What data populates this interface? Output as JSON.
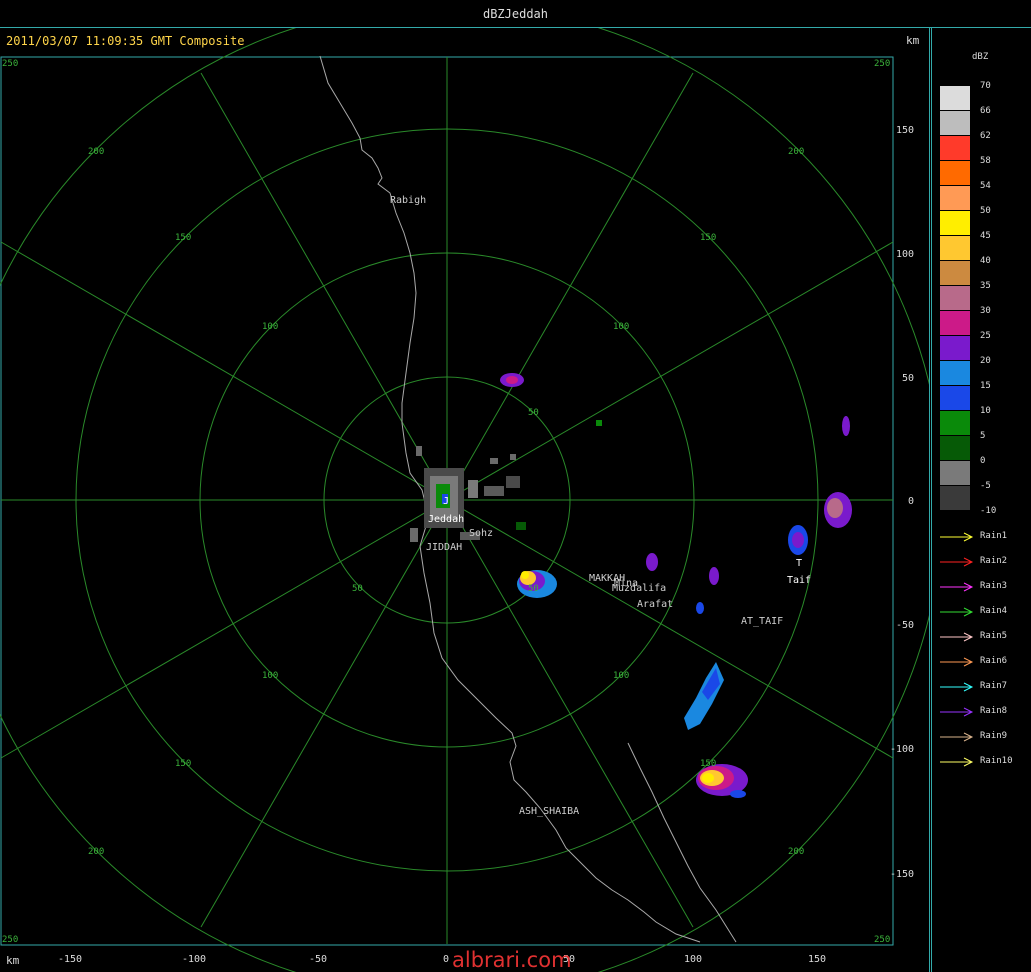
{
  "window": {
    "title": "dBZJeddah"
  },
  "radar": {
    "timestamp": "2011/03/07 11:09:35 GMT Composite",
    "unit": "km",
    "watermark": "albrari.com",
    "ring_labels": [
      "50",
      "100",
      "150",
      "200",
      "250"
    ],
    "x_ticks": [
      "-150",
      "-100",
      "-50",
      "0",
      "50",
      "100",
      "150"
    ],
    "y_ticks": [
      "150",
      "100",
      "50",
      "0",
      "-50",
      "-100",
      "-150"
    ],
    "places": {
      "rabigh": "Rabigh",
      "jeddah_marker": "J",
      "jeddah": "Jeddah",
      "jiddah": "JIDDAH",
      "sohz": "Sohz",
      "makkah": "MAKKAH",
      "mina": "Mina",
      "muzdalifa": "Muzdalifa",
      "arafat": "Arafat",
      "at_taif": "AT_TAIF",
      "taif_marker": "T",
      "taif": "Taif",
      "ash_shaiba": "ASH_SHAIBA"
    }
  },
  "legend": {
    "unit": "dBZ",
    "scale": [
      {
        "value": "70",
        "color": "#dcdcdc"
      },
      {
        "value": "66",
        "color": "#bdbdbd"
      },
      {
        "value": "62",
        "color": "#ff3a2a"
      },
      {
        "value": "58",
        "color": "#ff6a00"
      },
      {
        "value": "54",
        "color": "#ff9a55"
      },
      {
        "value": "50",
        "color": "#ffee00"
      },
      {
        "value": "45",
        "color": "#ffc830"
      },
      {
        "value": "40",
        "color": "#cc8a40"
      },
      {
        "value": "35",
        "color": "#b86a8a"
      },
      {
        "value": "30",
        "color": "#cc1a88"
      },
      {
        "value": "25",
        "color": "#7a1acc"
      },
      {
        "value": "20",
        "color": "#1a88e0"
      },
      {
        "value": "15",
        "color": "#1a48e8"
      },
      {
        "value": "10",
        "color": "#0a8a0a"
      },
      {
        "value": "5",
        "color": "#065a06"
      },
      {
        "value": "0",
        "color": "#7a7a7a"
      },
      {
        "value": "-5",
        "color": "#3a3a3a"
      }
    ],
    "bottom_value": "-10",
    "rain": [
      {
        "label": "Rain1",
        "color": "#ffff33"
      },
      {
        "label": "Rain2",
        "color": "#ff2222"
      },
      {
        "label": "Rain3",
        "color": "#ff33ff"
      },
      {
        "label": "Rain4",
        "color": "#33dd33"
      },
      {
        "label": "Rain5",
        "color": "#ffc8c8"
      },
      {
        "label": "Rain6",
        "color": "#ff9a55"
      },
      {
        "label": "Rain7",
        "color": "#33ffff"
      },
      {
        "label": "Rain8",
        "color": "#9933ff"
      },
      {
        "label": "Rain9",
        "color": "#d9b38c"
      },
      {
        "label": "Rain10",
        "color": "#ffff66"
      }
    ]
  }
}
